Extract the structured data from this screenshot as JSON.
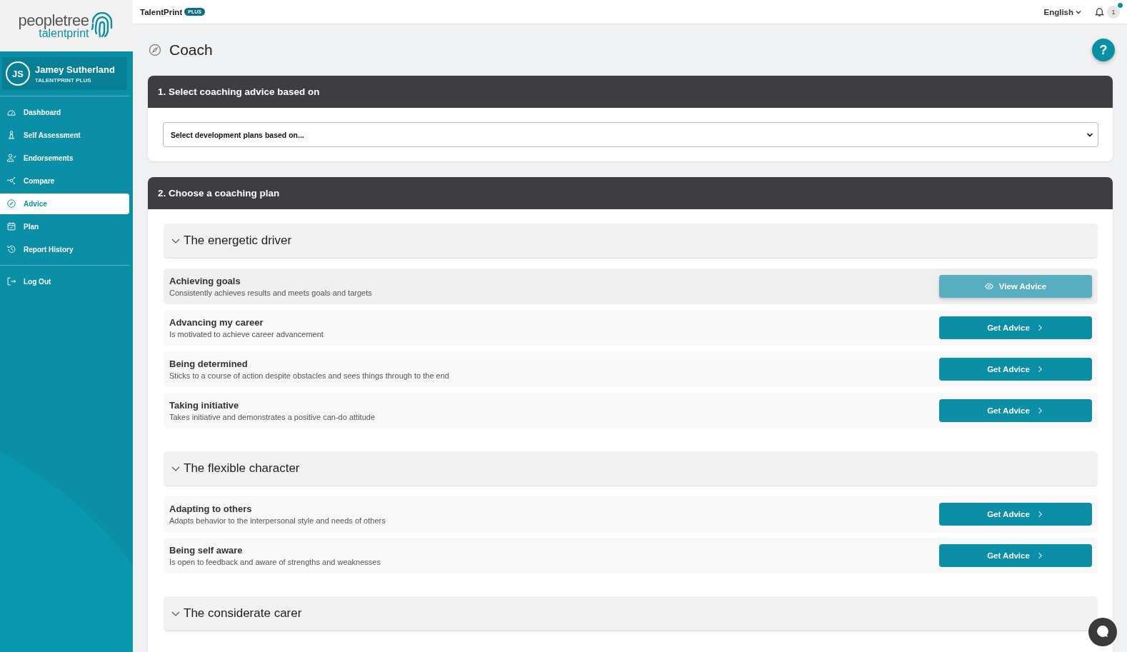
{
  "brand": {
    "wordmark": "peopletree",
    "product": "talentprint"
  },
  "user": {
    "initials": "JS",
    "name": "Jamey Sutherland",
    "plan": "TALENTPRINT PLUS"
  },
  "nav": [
    {
      "label": "Dashboard",
      "selected": false
    },
    {
      "label": "Self Assessment",
      "selected": false
    },
    {
      "label": "Endorsements",
      "selected": false
    },
    {
      "label": "Compare",
      "selected": false
    },
    {
      "label": "Advice",
      "selected": true
    },
    {
      "label": "Plan",
      "selected": false
    },
    {
      "label": "Report History",
      "selected": false
    }
  ],
  "footer_nav": [
    {
      "label": "Log Out",
      "selected": false
    }
  ],
  "topbar": {
    "product": "TalentPrint",
    "badge": "PLUS",
    "language": "English",
    "notifications": "1"
  },
  "page": {
    "title": "Coach",
    "help": "?"
  },
  "step1": {
    "title": "1. Select coaching advice based on",
    "select": "Select development plans based on..."
  },
  "step2": {
    "title": "2. Choose a coaching plan",
    "groups": [
      {
        "title": "The energetic driver",
        "expanded": true,
        "items": [
          {
            "name": "Achieving goals",
            "description": "Consistently achieves results and meets goals and targets",
            "viewed": true,
            "button": "View Advice"
          },
          {
            "name": "Advancing my career",
            "description": "Is motivated to achieve career advancement",
            "viewed": false,
            "button": "Get Advice"
          },
          {
            "name": "Being determined",
            "description": "Sticks to a course of action despite obstacles and sees things through to the end",
            "viewed": false,
            "button": "Get Advice"
          },
          {
            "name": "Taking initiative",
            "description": "Takes initiative and demonstrates a positive can-do attitude",
            "viewed": false,
            "button": "Get Advice"
          }
        ]
      },
      {
        "title": "The flexible character",
        "expanded": true,
        "items": [
          {
            "name": "Adapting to others",
            "description": "Adapts behavior to the interpersonal style and needs of others",
            "viewed": false,
            "button": "Get Advice"
          },
          {
            "name": "Being self aware",
            "description": "Is open to feedback and aware of strengths and weaknesses",
            "viewed": false,
            "button": "Get Advice"
          }
        ]
      },
      {
        "title": "The considerate carer",
        "expanded": true
      }
    ]
  }
}
